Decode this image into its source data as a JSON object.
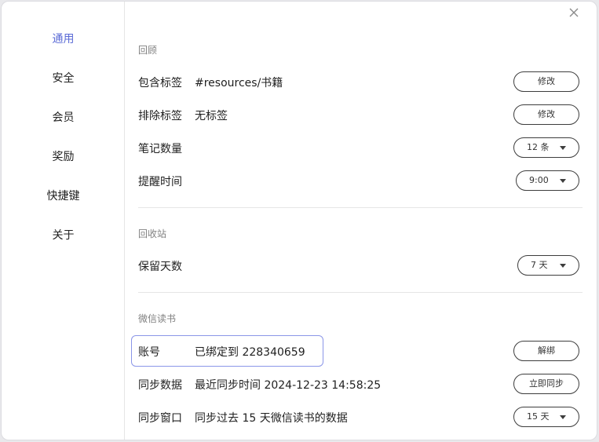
{
  "sidebar": {
    "items": [
      {
        "label": "通用",
        "active": true
      },
      {
        "label": "安全"
      },
      {
        "label": "会员"
      },
      {
        "label": "奖励"
      },
      {
        "label": "快捷键"
      },
      {
        "label": "关于"
      }
    ]
  },
  "review": {
    "title": "回顾",
    "include_tags": {
      "label": "包含标签",
      "value": "#resources/书籍",
      "button": "修改"
    },
    "exclude_tags": {
      "label": "排除标签",
      "value": "无标签",
      "button": "修改"
    },
    "note_count": {
      "label": "笔记数量",
      "value": "12 条"
    },
    "reminder_time": {
      "label": "提醒时间",
      "value": "9:00"
    }
  },
  "trash": {
    "title": "回收站",
    "keep_days": {
      "label": "保留天数",
      "value": "7 天"
    }
  },
  "wechat_read": {
    "title": "微信读书",
    "account": {
      "label": "账号",
      "value": "已绑定到 228340659",
      "button": "解绑"
    },
    "sync_data": {
      "label": "同步数据",
      "value": "最近同步时间 2024-12-23 14:58:25",
      "button": "立即同步"
    },
    "sync_window": {
      "label": "同步窗口",
      "value": "同步过去 15 天微信读书的数据",
      "select": "15 天"
    }
  },
  "colors": {
    "accent": "#5b6bd6",
    "highlight_border": "#8b96e8"
  }
}
